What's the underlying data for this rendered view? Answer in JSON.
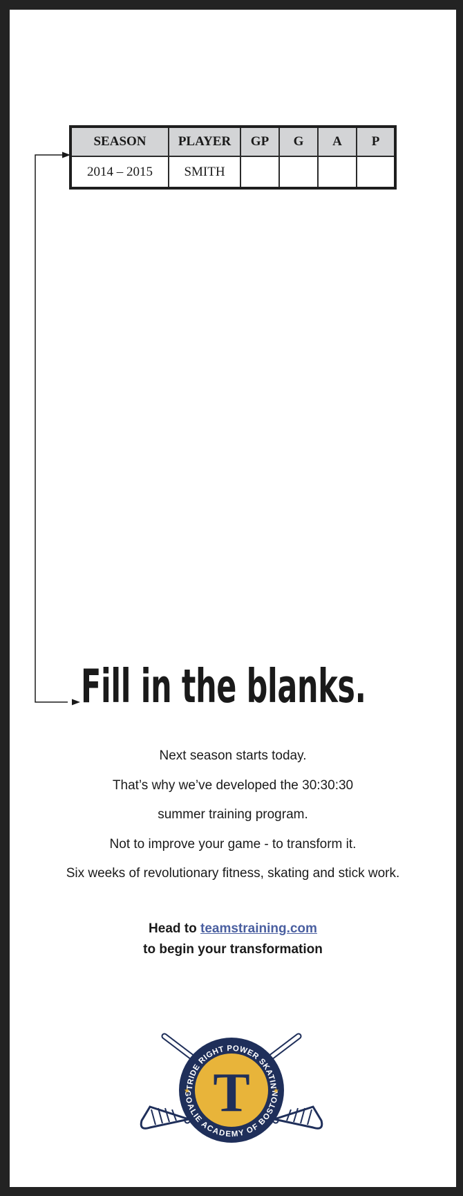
{
  "stats_table": {
    "headers": [
      "SEASON",
      "PLAYER",
      "GP",
      "G",
      "A",
      "P"
    ],
    "row": [
      "2014 – 2015",
      "SMITH",
      "",
      "",
      "",
      ""
    ]
  },
  "headline": "Fill in the blanks.",
  "body_lines": [
    "Next season starts today.",
    "That’s why we’ve developed the 30:30:30",
    "summer training program.",
    "Not to improve your game - to transform it.",
    "Six weeks of revolutionary fitness, skating and stick work."
  ],
  "cta": {
    "prefix": "Head to ",
    "link": "teamstraining.com",
    "line2": "to begin your transformation"
  },
  "logo": {
    "top_arc_text": "STRIDE RIGHT POWER SKATING",
    "bottom_arc_text": "GOALIE ACADEMY OF BOSTON",
    "monogram": "T",
    "colors": {
      "navy": "#1f2f5a",
      "gold": "#e8b43a"
    }
  },
  "colors": {
    "frame": "#232323",
    "link": "#4a5fa0",
    "table_header": "#d3d4d6"
  }
}
